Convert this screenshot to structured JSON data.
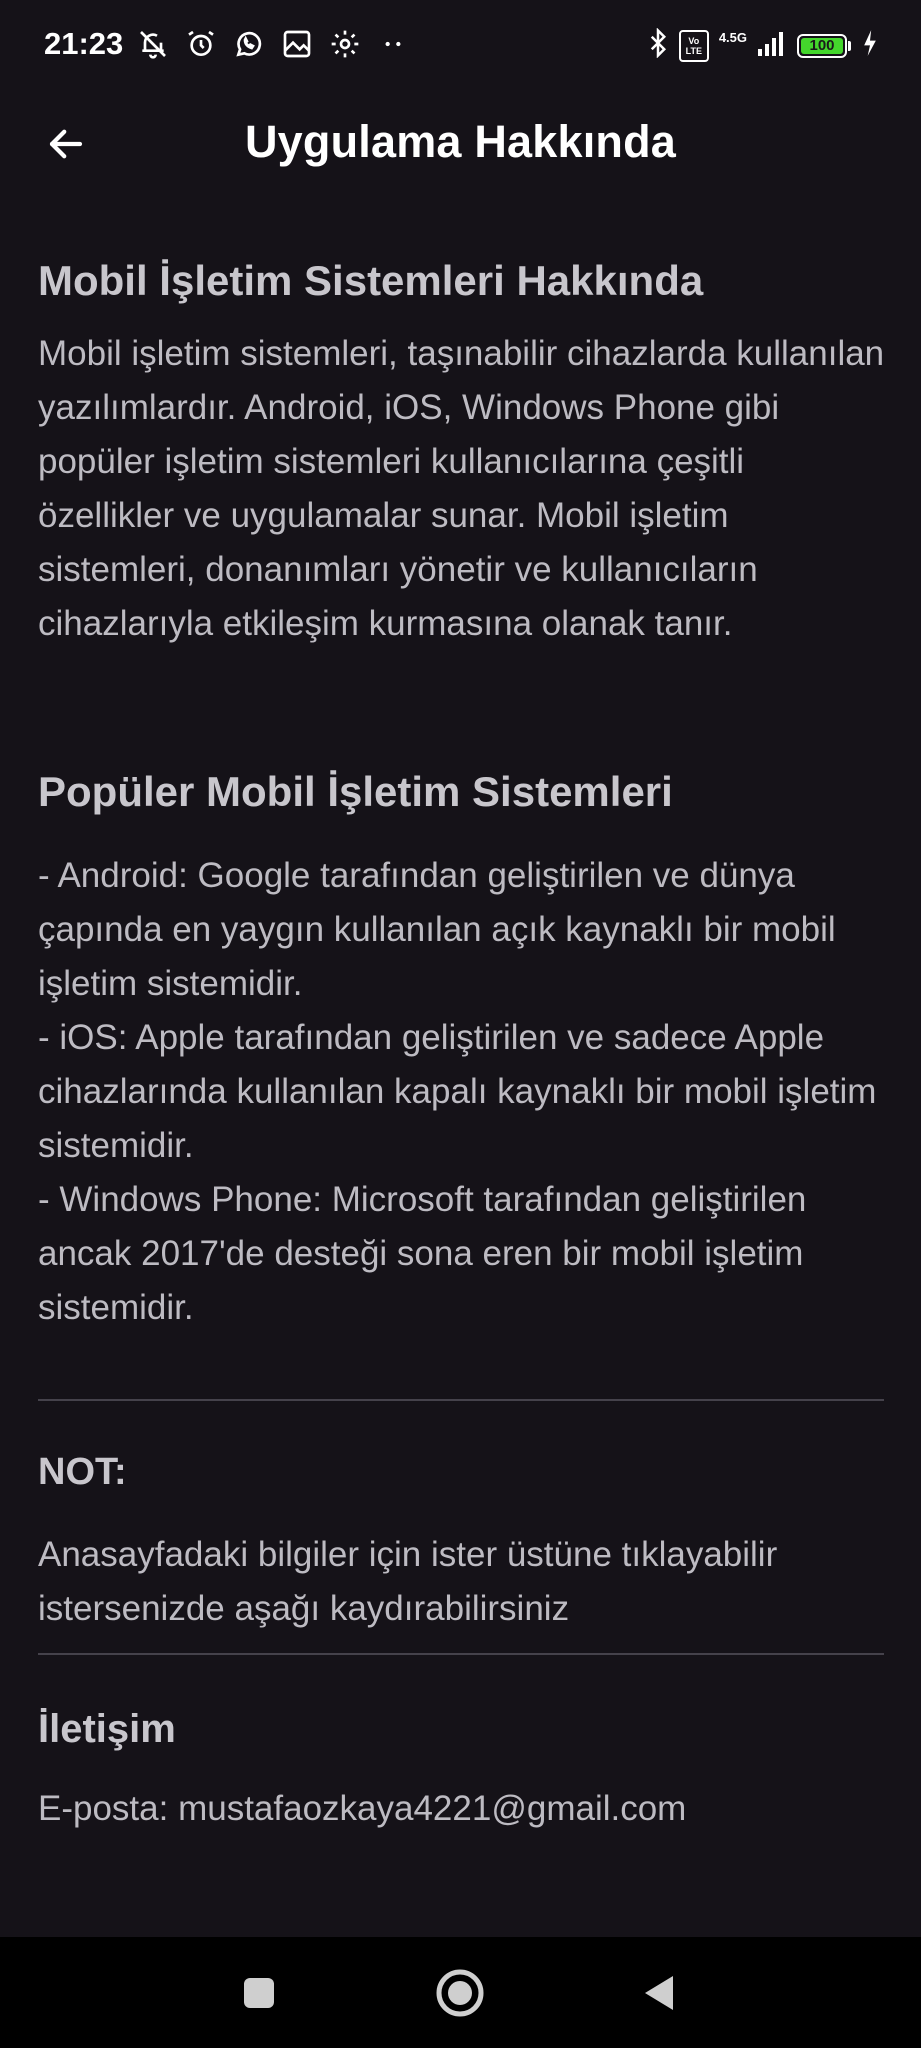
{
  "status_bar": {
    "time": "21:23",
    "network_type": "4.5G",
    "volte_top": "Vo",
    "volte_bottom": "LTE",
    "battery_level": "100",
    "battery_color": "#44d62c"
  },
  "header": {
    "title": "Uygulama Hakkında",
    "back_icon": "arrow-left-icon"
  },
  "about": {
    "heading": "Mobil İşletim Sistemleri Hakkında",
    "text": "Mobil işletim sistemleri, taşınabilir cihazlarda kullanılan yazılımlardır. Android, iOS, Windows Phone gibi popüler işletim sistemleri kullanıcılarına çeşitli özellikler ve uygulamalar sunar. Mobil işletim sistemleri, donanımları yönetir ve kullanıcıların cihazlarıyla etkileşim kurmasına olanak tanır."
  },
  "popular": {
    "heading": "Popüler Mobil İşletim Sistemleri",
    "items": [
      "- Android: Google tarafından geliştirilen ve dünya çapında en yaygın kullanılan açık kaynaklı bir mobil işletim sistemidir.",
      "- iOS: Apple tarafından geliştirilen ve sadece Apple cihazlarında kullanılan kapalı kaynaklı bir mobil işletim sistemidir.",
      "- Windows Phone: Microsoft tarafından geliştirilen ancak 2017'de desteği sona eren bir mobil işletim sistemidir."
    ]
  },
  "note": {
    "heading": "NOT:",
    "text": "Anasayfadaki bilgiler için ister üstüne tıklayabilir istersenizde aşağı kaydırabilirsiniz"
  },
  "contact": {
    "heading": "İletişim",
    "email_line": "E-posta: mustafaozkaya4221@gmail.com"
  },
  "nav_bar": {
    "icons": [
      "recents-square-icon",
      "home-circle-icon",
      "back-triangle-icon"
    ]
  },
  "colors": {
    "background": "#151218",
    "text": "#bdbbc2",
    "heading": "#c8c6cc",
    "title": "#ffffff",
    "divider": "#45424b"
  }
}
